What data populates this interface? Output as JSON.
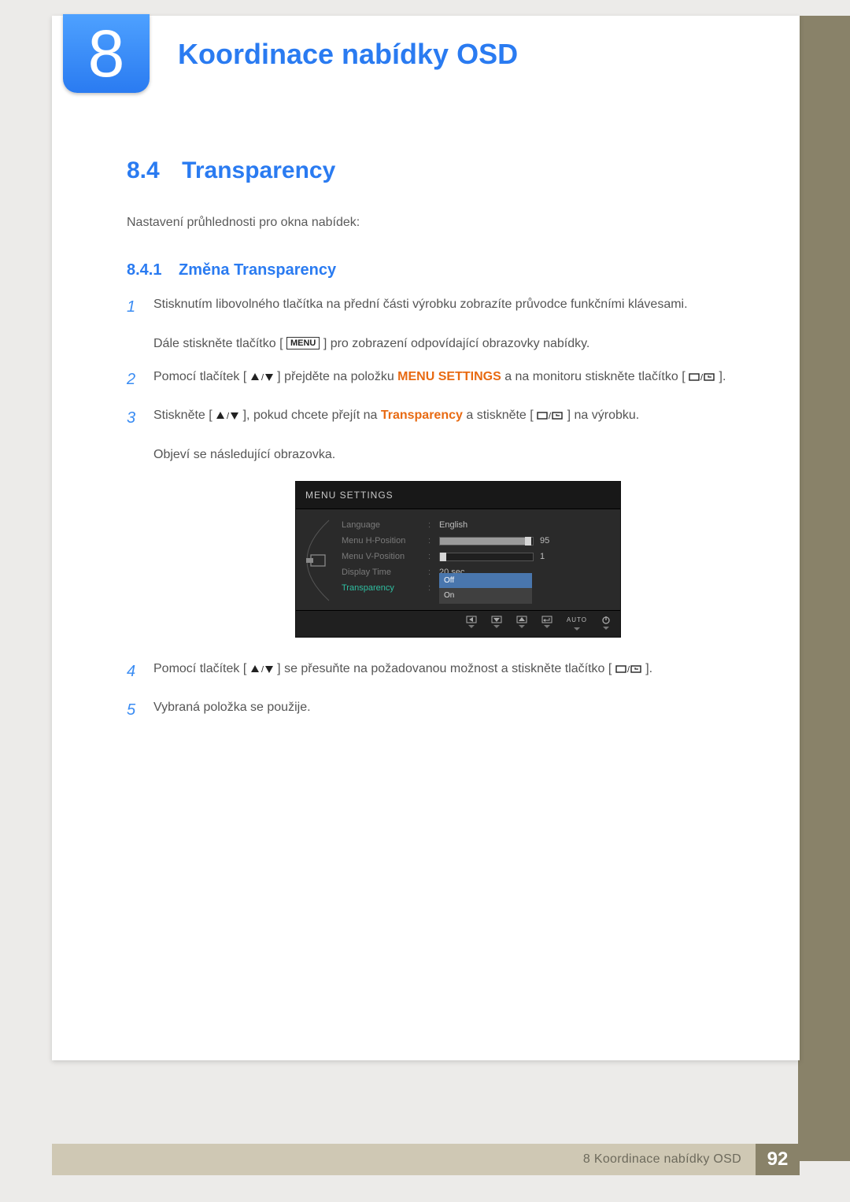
{
  "chapter": {
    "number": "8",
    "title": "Koordinace nabídky OSD"
  },
  "section": {
    "number": "8.4",
    "title": "Transparency"
  },
  "intro": "Nastavení průhlednosti pro okna nabídek:",
  "subsection": {
    "number": "8.4.1",
    "title": "Změna Transparency"
  },
  "steps": {
    "s1": {
      "n": "1",
      "text": "Stisknutím libovolného tlačítka na přední části výrobku zobrazíte průvodce funkčními klávesami."
    },
    "s1b": {
      "pre": "Dále stiskněte tlačítko [",
      "menu": "MENU",
      "post": "] pro zobrazení odpovídající obrazovky nabídky."
    },
    "s2": {
      "n": "2",
      "pre": "Pomocí tlačítek [",
      "mid": "] přejděte na položku ",
      "hi": "MENU SETTINGS",
      "post": " a na monitoru stiskněte tlačítko [",
      "tail": "]."
    },
    "s3": {
      "n": "3",
      "pre": "Stiskněte [",
      "mid1": "], pokud chcete přejít na ",
      "hi": "Transparency",
      "mid2": " a stiskněte [",
      "post": "] na výrobku."
    },
    "s3b": "Objeví se následující obrazovka.",
    "s4": {
      "n": "4",
      "pre": "Pomocí tlačítek [",
      "mid": "] se přesuňte na požadovanou možnost a stiskněte tlačítko [",
      "post": "]."
    },
    "s5": {
      "n": "5",
      "text": "Vybraná položka se použije."
    }
  },
  "osd": {
    "title": "MENU SETTINGS",
    "rows": {
      "language": {
        "label": "Language",
        "value": "English"
      },
      "hpos": {
        "label": "Menu H-Position",
        "value": "95",
        "fill": 95
      },
      "vpos": {
        "label": "Menu V-Position",
        "value": "1",
        "fill": 1
      },
      "dtime": {
        "label": "Display Time",
        "value": "20 sec"
      },
      "trans": {
        "label": "Transparency",
        "opt_off": "Off",
        "opt_on": "On"
      }
    },
    "footer": {
      "auto": "AUTO"
    }
  },
  "footer": {
    "text": "8 Koordinace nabídky OSD",
    "page": "92"
  }
}
